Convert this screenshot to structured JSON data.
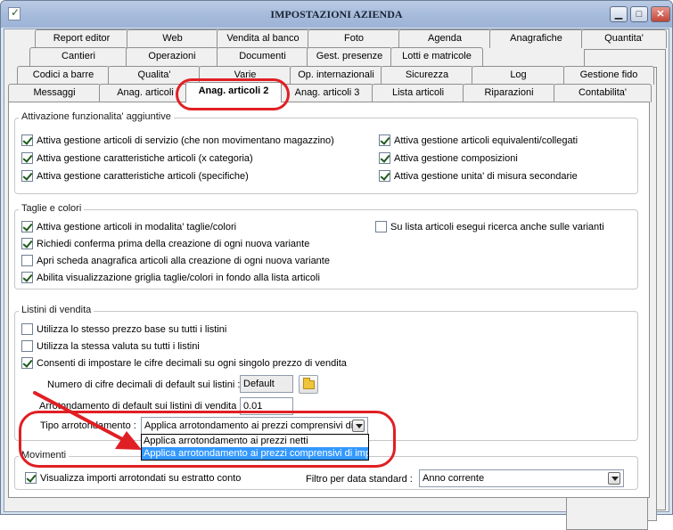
{
  "window": {
    "title": "IMPOSTAZIONI AZIENDA"
  },
  "tabs": {
    "row1": [
      "Report editor",
      "Web",
      "Vendita al banco",
      "Foto",
      "Agenda",
      "Anagrafiche",
      "Quantita'"
    ],
    "row2": [
      "Cantieri",
      "Operazioni",
      "Documenti",
      "Gest. presenze",
      "Lotti e matricole"
    ],
    "row3": [
      "Codici a barre",
      "Qualita'",
      "Varie",
      "Op. internazionali",
      "Sicurezza",
      "Log",
      "Gestione fido"
    ],
    "row4": [
      "Messaggi",
      "Anag. articoli",
      "Anag. articoli 2",
      "Anag. articoli 3",
      "Lista articoli",
      "Riparazioni",
      "Contabilita'"
    ]
  },
  "groups": {
    "attivazione": {
      "title": "Attivazione funzionalita' aggiuntive",
      "left": [
        {
          "label": "Attiva gestione articoli di servizio (che non movimentano magazzino)",
          "checked": true
        },
        {
          "label": "Attiva gestione caratteristiche articoli (x categoria)",
          "checked": true
        },
        {
          "label": "Attiva gestione caratteristiche articoli (specifiche)",
          "checked": true
        }
      ],
      "right": [
        {
          "label": "Attiva gestione articoli equivalenti/collegati",
          "checked": true
        },
        {
          "label": "Attiva gestione composizioni",
          "checked": true
        },
        {
          "label": "Attiva gestione unita' di misura secondarie",
          "checked": true
        }
      ]
    },
    "taglie": {
      "title": "Taglie e colori",
      "left": [
        {
          "label": "Attiva gestione articoli in modalita' taglie/colori",
          "checked": true
        },
        {
          "label": "Richiedi conferma prima della creazione di ogni nuova variante",
          "checked": true
        },
        {
          "label": "Apri scheda anagrafica articoli alla creazione di ogni nuova variante",
          "checked": false
        },
        {
          "label": "Abilita visualizzazione griglia taglie/colori in fondo alla lista articoli",
          "checked": true
        }
      ],
      "right": [
        {
          "label": "Su lista articoli esegui ricerca anche sulle varianti",
          "checked": false
        }
      ]
    },
    "listini": {
      "title": "Listini di vendita",
      "checks": [
        {
          "label": "Utilizza lo stesso prezzo base su tutti i listini",
          "checked": false
        },
        {
          "label": "Utilizza la stessa valuta su tutti i listini",
          "checked": false
        },
        {
          "label": "Consenti di impostare le cifre decimali su ogni singolo prezzo di vendita",
          "checked": true
        }
      ],
      "decimali_label": "Numero di cifre decimali di default sui listini :",
      "decimali_value": "Default",
      "arrotondamento_label": "Arrotondamento di default sui listini di vendita :",
      "arrotondamento_value": "0.01",
      "tipo_label": "Tipo arrotondamento :",
      "tipo_value": "Applica arrotondamento ai prezzi comprensivi di",
      "tipo_options": [
        "Applica arrotondamento ai prezzi netti",
        "Applica arrotondamento ai prezzi comprensivi di impo"
      ],
      "tipo_selected_index": 1
    },
    "movimenti": {
      "title": "Movimenti",
      "check": {
        "label": "Visualizza importi arrotondati su estratto conto",
        "checked": true
      },
      "filtro_label": "Filtro per data standard :",
      "filtro_value": "Anno corrente"
    }
  },
  "colors": {
    "annotation": "#e01f24",
    "selection": "#3399ff"
  }
}
